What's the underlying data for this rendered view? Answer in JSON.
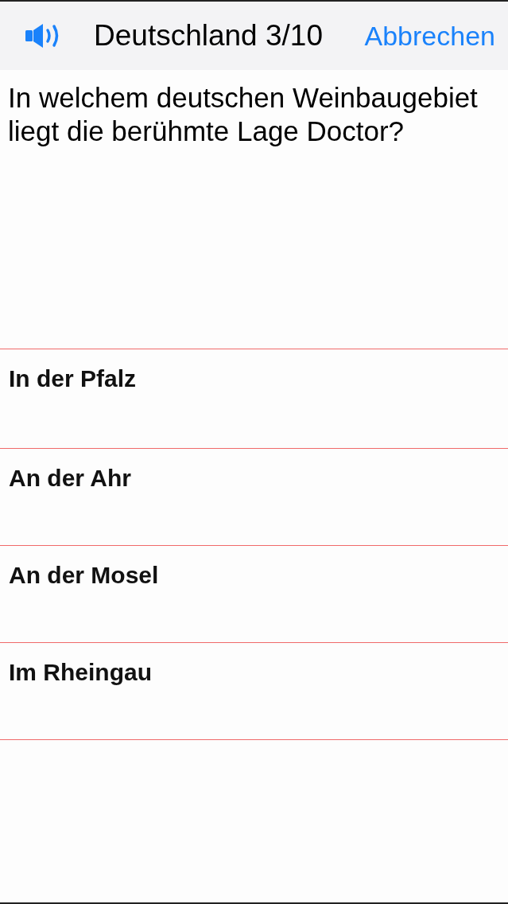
{
  "header": {
    "title": "Deutschland 3/10",
    "cancel": "Abbrechen"
  },
  "question": {
    "text": "In welchem deutschen Weinbaugebiet liegt die berühmte Lage Doctor?"
  },
  "answers": [
    {
      "label": "In der Pfalz"
    },
    {
      "label": "An der Ahr"
    },
    {
      "label": "An der Mosel"
    },
    {
      "label": "Im Rheingau"
    }
  ]
}
